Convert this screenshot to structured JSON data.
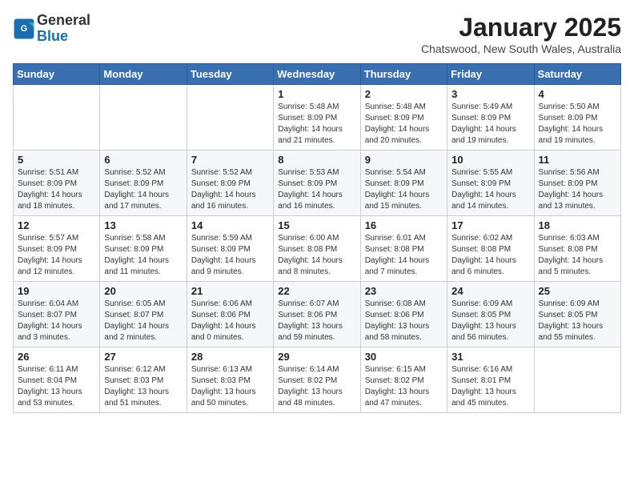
{
  "header": {
    "logo_line1": "General",
    "logo_line2": "Blue",
    "title": "January 2025",
    "subtitle": "Chatswood, New South Wales, Australia"
  },
  "weekdays": [
    "Sunday",
    "Monday",
    "Tuesday",
    "Wednesday",
    "Thursday",
    "Friday",
    "Saturday"
  ],
  "weeks": [
    [
      {
        "day": "",
        "info": ""
      },
      {
        "day": "",
        "info": ""
      },
      {
        "day": "",
        "info": ""
      },
      {
        "day": "1",
        "info": "Sunrise: 5:48 AM\nSunset: 8:09 PM\nDaylight: 14 hours\nand 21 minutes."
      },
      {
        "day": "2",
        "info": "Sunrise: 5:48 AM\nSunset: 8:09 PM\nDaylight: 14 hours\nand 20 minutes."
      },
      {
        "day": "3",
        "info": "Sunrise: 5:49 AM\nSunset: 8:09 PM\nDaylight: 14 hours\nand 19 minutes."
      },
      {
        "day": "4",
        "info": "Sunrise: 5:50 AM\nSunset: 8:09 PM\nDaylight: 14 hours\nand 19 minutes."
      }
    ],
    [
      {
        "day": "5",
        "info": "Sunrise: 5:51 AM\nSunset: 8:09 PM\nDaylight: 14 hours\nand 18 minutes."
      },
      {
        "day": "6",
        "info": "Sunrise: 5:52 AM\nSunset: 8:09 PM\nDaylight: 14 hours\nand 17 minutes."
      },
      {
        "day": "7",
        "info": "Sunrise: 5:52 AM\nSunset: 8:09 PM\nDaylight: 14 hours\nand 16 minutes."
      },
      {
        "day": "8",
        "info": "Sunrise: 5:53 AM\nSunset: 8:09 PM\nDaylight: 14 hours\nand 16 minutes."
      },
      {
        "day": "9",
        "info": "Sunrise: 5:54 AM\nSunset: 8:09 PM\nDaylight: 14 hours\nand 15 minutes."
      },
      {
        "day": "10",
        "info": "Sunrise: 5:55 AM\nSunset: 8:09 PM\nDaylight: 14 hours\nand 14 minutes."
      },
      {
        "day": "11",
        "info": "Sunrise: 5:56 AM\nSunset: 8:09 PM\nDaylight: 14 hours\nand 13 minutes."
      }
    ],
    [
      {
        "day": "12",
        "info": "Sunrise: 5:57 AM\nSunset: 8:09 PM\nDaylight: 14 hours\nand 12 minutes."
      },
      {
        "day": "13",
        "info": "Sunrise: 5:58 AM\nSunset: 8:09 PM\nDaylight: 14 hours\nand 11 minutes."
      },
      {
        "day": "14",
        "info": "Sunrise: 5:59 AM\nSunset: 8:09 PM\nDaylight: 14 hours\nand 9 minutes."
      },
      {
        "day": "15",
        "info": "Sunrise: 6:00 AM\nSunset: 8:08 PM\nDaylight: 14 hours\nand 8 minutes."
      },
      {
        "day": "16",
        "info": "Sunrise: 6:01 AM\nSunset: 8:08 PM\nDaylight: 14 hours\nand 7 minutes."
      },
      {
        "day": "17",
        "info": "Sunrise: 6:02 AM\nSunset: 8:08 PM\nDaylight: 14 hours\nand 6 minutes."
      },
      {
        "day": "18",
        "info": "Sunrise: 6:03 AM\nSunset: 8:08 PM\nDaylight: 14 hours\nand 5 minutes."
      }
    ],
    [
      {
        "day": "19",
        "info": "Sunrise: 6:04 AM\nSunset: 8:07 PM\nDaylight: 14 hours\nand 3 minutes."
      },
      {
        "day": "20",
        "info": "Sunrise: 6:05 AM\nSunset: 8:07 PM\nDaylight: 14 hours\nand 2 minutes."
      },
      {
        "day": "21",
        "info": "Sunrise: 6:06 AM\nSunset: 8:06 PM\nDaylight: 14 hours\nand 0 minutes."
      },
      {
        "day": "22",
        "info": "Sunrise: 6:07 AM\nSunset: 8:06 PM\nDaylight: 13 hours\nand 59 minutes."
      },
      {
        "day": "23",
        "info": "Sunrise: 6:08 AM\nSunset: 8:06 PM\nDaylight: 13 hours\nand 58 minutes."
      },
      {
        "day": "24",
        "info": "Sunrise: 6:09 AM\nSunset: 8:05 PM\nDaylight: 13 hours\nand 56 minutes."
      },
      {
        "day": "25",
        "info": "Sunrise: 6:09 AM\nSunset: 8:05 PM\nDaylight: 13 hours\nand 55 minutes."
      }
    ],
    [
      {
        "day": "26",
        "info": "Sunrise: 6:11 AM\nSunset: 8:04 PM\nDaylight: 13 hours\nand 53 minutes."
      },
      {
        "day": "27",
        "info": "Sunrise: 6:12 AM\nSunset: 8:03 PM\nDaylight: 13 hours\nand 51 minutes."
      },
      {
        "day": "28",
        "info": "Sunrise: 6:13 AM\nSunset: 8:03 PM\nDaylight: 13 hours\nand 50 minutes."
      },
      {
        "day": "29",
        "info": "Sunrise: 6:14 AM\nSunset: 8:02 PM\nDaylight: 13 hours\nand 48 minutes."
      },
      {
        "day": "30",
        "info": "Sunrise: 6:15 AM\nSunset: 8:02 PM\nDaylight: 13 hours\nand 47 minutes."
      },
      {
        "day": "31",
        "info": "Sunrise: 6:16 AM\nSunset: 8:01 PM\nDaylight: 13 hours\nand 45 minutes."
      },
      {
        "day": "",
        "info": ""
      }
    ]
  ]
}
